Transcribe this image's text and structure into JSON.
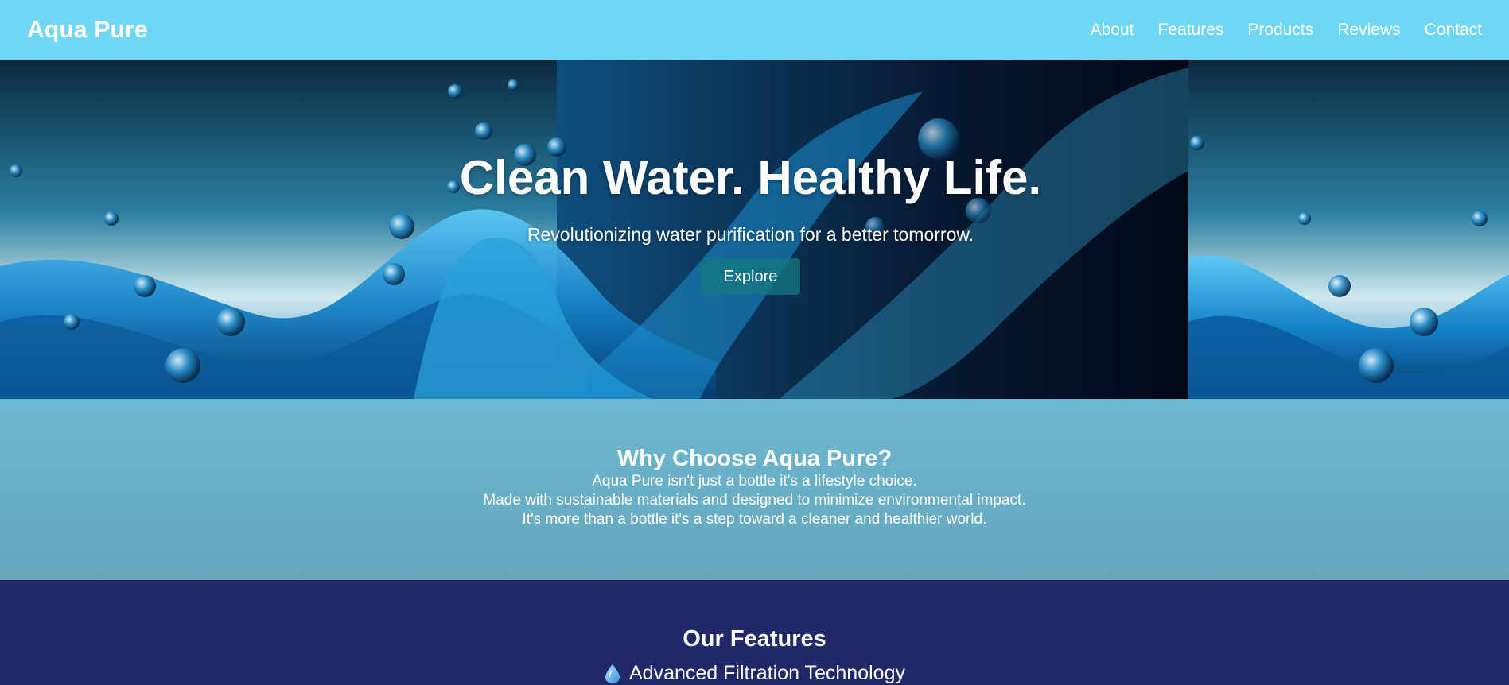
{
  "header": {
    "brand": "Aqua Pure",
    "nav": [
      "About",
      "Features",
      "Products",
      "Reviews",
      "Contact"
    ]
  },
  "hero": {
    "title": "Clean Water. Healthy Life.",
    "subtitle": "Revolutionizing water purification for a better tomorrow.",
    "button": "Explore",
    "background": "water-splash-image"
  },
  "why": {
    "heading": "Why Choose Aqua Pure?",
    "lines": [
      "Aqua Pure isn't just a bottle it's a lifestyle choice.",
      "Made with sustainable materials and designed to minimize environmental impact.",
      "It's more than a bottle it's a step toward a cleaner and healthier world."
    ]
  },
  "features": {
    "heading": "Our Features",
    "items": [
      {
        "icon": "water-drop-icon",
        "label": "Advanced Filtration Technology"
      }
    ]
  },
  "colors": {
    "header_bg": "#6fd6f5",
    "why_bg": "#69b0c8",
    "features_bg": "#22296b",
    "button_bg": "#1b7f88"
  }
}
